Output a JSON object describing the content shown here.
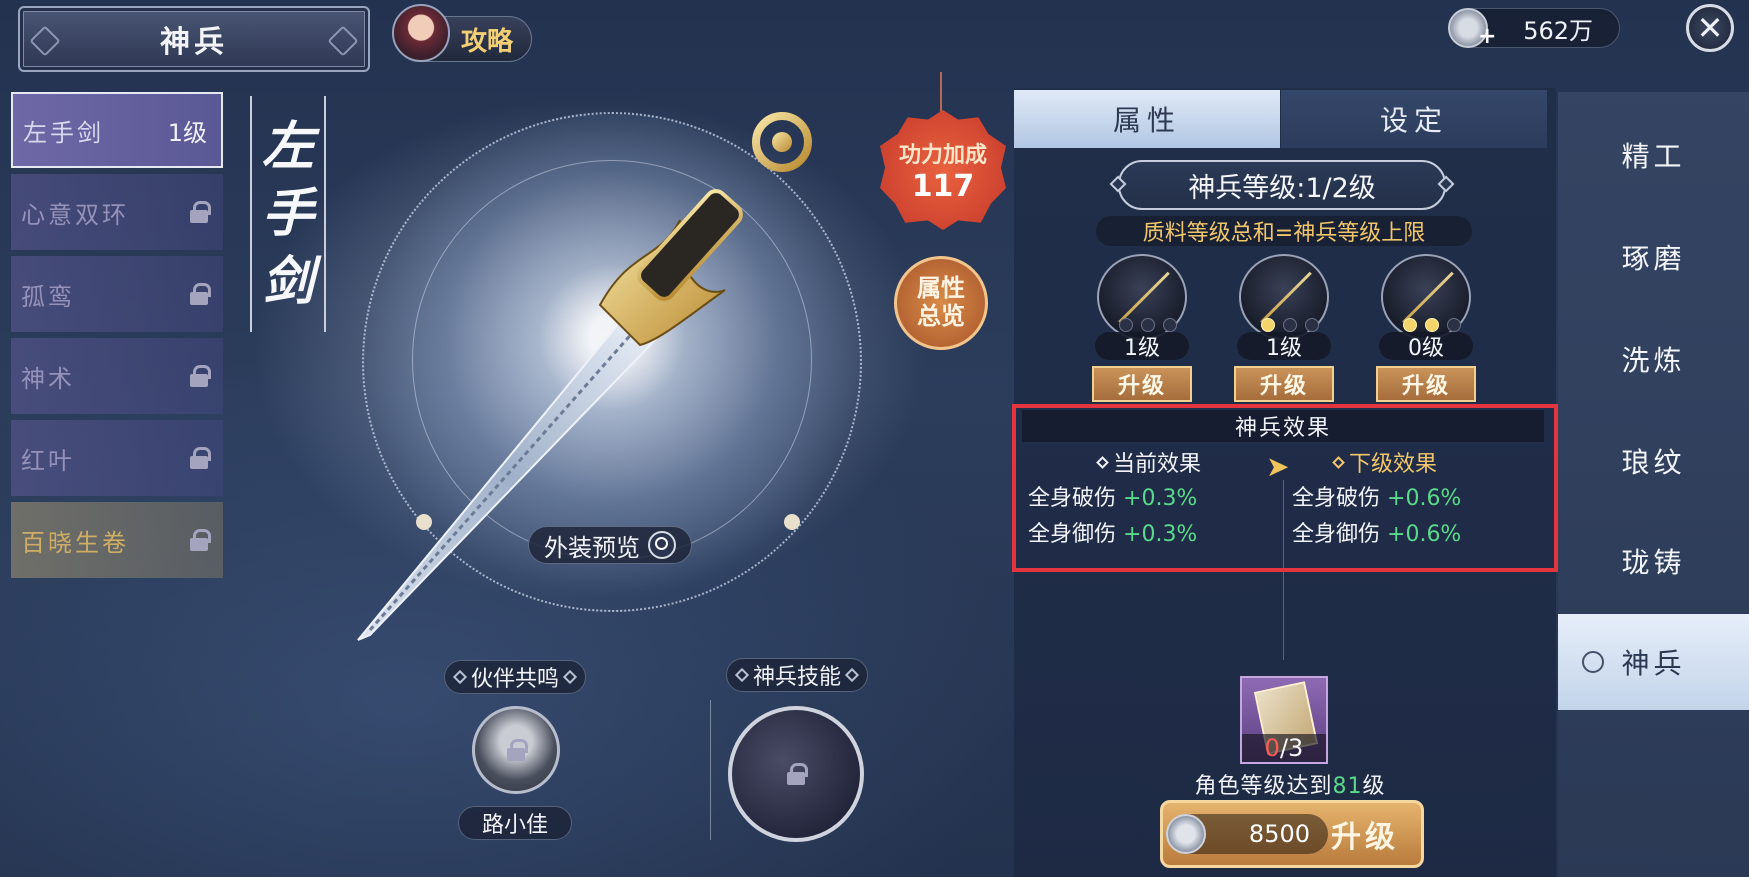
{
  "header": {
    "title": "神兵",
    "guide_label": "攻略",
    "currency": "562万",
    "close_symbol": "✕"
  },
  "sidebar": {
    "items": [
      {
        "name": "左手剑",
        "level": "1级",
        "locked": false,
        "active": true
      },
      {
        "name": "心意双环",
        "level": "",
        "locked": true
      },
      {
        "name": "孤鸾",
        "level": "",
        "locked": true
      },
      {
        "name": "神术",
        "level": "",
        "locked": true
      },
      {
        "name": "红叶",
        "level": "",
        "locked": true
      },
      {
        "name": "百晓生卷",
        "level": "",
        "locked": true,
        "gold": true
      }
    ]
  },
  "weapon": {
    "vertical_name": [
      "左",
      "手",
      "剑"
    ],
    "power_label": "功力加成",
    "power_value": "117",
    "attr_overview": [
      "属性",
      "总览"
    ],
    "preview_label": "外装预览"
  },
  "bottom": {
    "partner_label": "伙伴共鸣",
    "partner_name": "路小佳",
    "skill_label": "神兵技能"
  },
  "panel": {
    "tabs": [
      "属性",
      "设定"
    ],
    "level_text": "神兵等级:1/2级",
    "rule_text": "质料等级总和=神兵等级上限",
    "materials": [
      {
        "level": "1级",
        "lit": 0
      },
      {
        "level": "1级",
        "lit": 1
      },
      {
        "level": "0级",
        "lit": 2
      }
    ],
    "upgrade_label": "升级",
    "effects": {
      "title": "神兵效果",
      "current_label": "当前效果",
      "next_label": "下级效果",
      "current": [
        {
          "name": "全身破伤",
          "value": "+0.3%"
        },
        {
          "name": "全身御伤",
          "value": "+0.3%"
        }
      ],
      "next": [
        {
          "name": "全身破伤",
          "value": "+0.6%"
        },
        {
          "name": "全身御伤",
          "value": "+0.6%"
        }
      ]
    },
    "requirement": {
      "have": "0",
      "need": "/3",
      "text_prefix": "角色等级达到",
      "text_level": "81",
      "text_suffix": "级"
    },
    "upgrade_cost": "8500",
    "upgrade_button": "升级"
  },
  "right_nav": {
    "items": [
      "精工",
      "琢磨",
      "洗炼",
      "琅纹",
      "珑铸",
      "神兵"
    ],
    "active_index": 5
  },
  "colors": {
    "accent_gold": "#f2c66a",
    "positive_green": "#59d98a",
    "highlight_red": "#e4343d"
  }
}
